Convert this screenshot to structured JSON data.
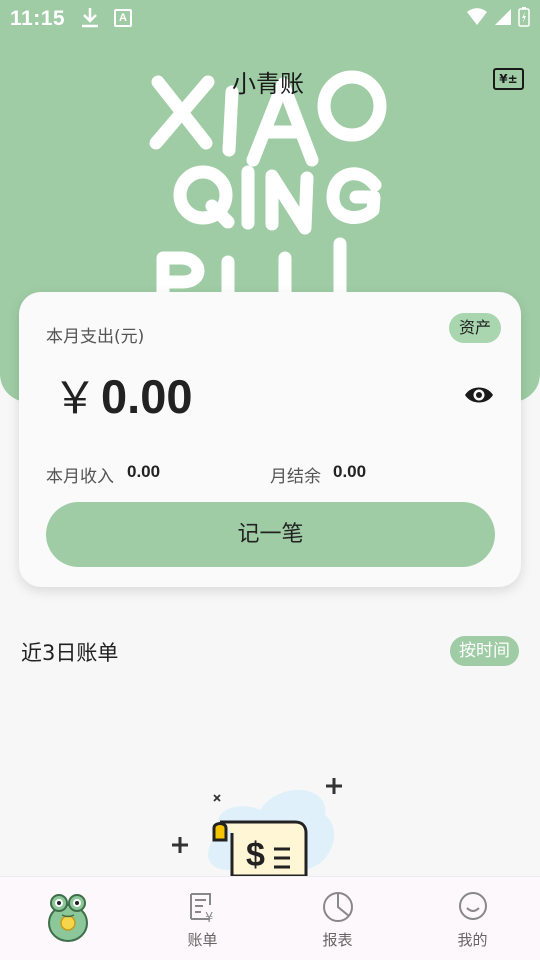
{
  "status_bar": {
    "time": "11:15",
    "badge_letter": "A"
  },
  "header": {
    "title": "小青账",
    "wallet_icon_text": "¥±",
    "decorative_text": [
      "XIAO",
      "QING",
      "BULL"
    ]
  },
  "summary_card": {
    "expense_label": "本月支出(元)",
    "asset_badge": "资产",
    "currency_symbol": "￥",
    "expense_amount": "0.00",
    "income_label": "本月收入",
    "income_value": "0.00",
    "balance_label": "月结余",
    "balance_value": "0.00",
    "record_button": "记一笔"
  },
  "recent_bills": {
    "title": "近3日账单",
    "sort_button": "按时间"
  },
  "bottom_nav": {
    "items": [
      {
        "label": "",
        "icon": "frog-mascot-icon"
      },
      {
        "label": "账单",
        "icon": "bill-icon"
      },
      {
        "label": "报表",
        "icon": "pie-chart-icon"
      },
      {
        "label": "我的",
        "icon": "smiley-icon"
      }
    ]
  },
  "colors": {
    "brand_green": "#9fcca5",
    "badge_green": "#a9d6ae"
  }
}
